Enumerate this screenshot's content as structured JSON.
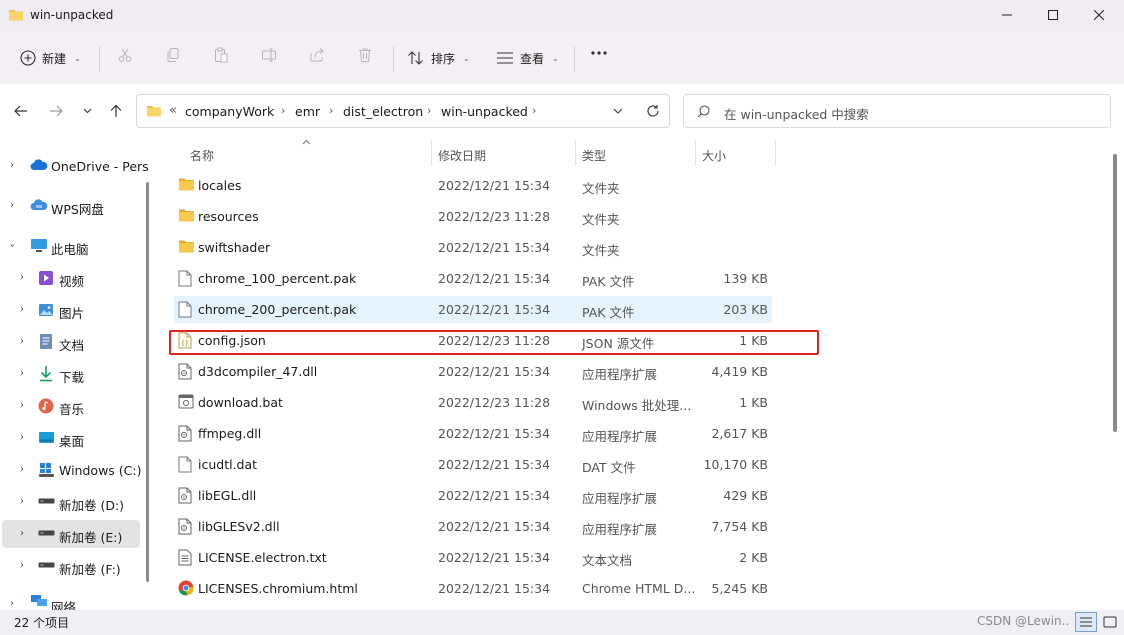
{
  "window": {
    "title": "win-unpacked"
  },
  "commands": {
    "new_label": "新建",
    "sort_label": "排序",
    "view_label": "查看"
  },
  "breadcrumb": {
    "overflow": "«",
    "items": [
      "companyWork",
      "emr",
      "dist_electron",
      "win-unpacked"
    ]
  },
  "search": {
    "placeholder": "在 win-unpacked 中搜索"
  },
  "sidebar": {
    "items": [
      {
        "label": "OneDrive - Pers",
        "icon": "cloud-icon"
      },
      {
        "label": "WPS网盘",
        "icon": "cloud-icon"
      },
      {
        "label": "此电脑",
        "icon": "computer-icon"
      },
      {
        "label": "视频",
        "icon": "video-icon"
      },
      {
        "label": "图片",
        "icon": "picture-icon"
      },
      {
        "label": "文档",
        "icon": "document-icon"
      },
      {
        "label": "下载",
        "icon": "download-icon"
      },
      {
        "label": "音乐",
        "icon": "music-icon"
      },
      {
        "label": "桌面",
        "icon": "desktop-icon"
      },
      {
        "label": "Windows (C:)",
        "icon": "windows-drive-icon"
      },
      {
        "label": "新加卷 (D:)",
        "icon": "drive-icon"
      },
      {
        "label": "新加卷 (E:)",
        "icon": "drive-icon"
      },
      {
        "label": "新加卷 (F:)",
        "icon": "drive-icon"
      },
      {
        "label": "网络",
        "icon": "network-icon"
      }
    ]
  },
  "columns": {
    "name": "名称",
    "date": "修改日期",
    "type": "类型",
    "size": "大小"
  },
  "files": [
    {
      "name": "locales",
      "date": "2022/12/21 15:34",
      "type": "文件夹",
      "size": "",
      "icon": "folder-icon"
    },
    {
      "name": "resources",
      "date": "2022/12/23 11:28",
      "type": "文件夹",
      "size": "",
      "icon": "folder-icon"
    },
    {
      "name": "swiftshader",
      "date": "2022/12/21 15:34",
      "type": "文件夹",
      "size": "",
      "icon": "folder-icon"
    },
    {
      "name": "chrome_100_percent.pak",
      "date": "2022/12/21 15:34",
      "type": "PAK 文件",
      "size": "139 KB",
      "icon": "file-icon"
    },
    {
      "name": "chrome_200_percent.pak",
      "date": "2022/12/21 15:34",
      "type": "PAK 文件",
      "size": "203 KB",
      "icon": "file-icon"
    },
    {
      "name": "config.json",
      "date": "2022/12/23 11:28",
      "type": "JSON 源文件",
      "size": "1 KB",
      "icon": "json-file-icon"
    },
    {
      "name": "d3dcompiler_47.dll",
      "date": "2022/12/21 15:34",
      "type": "应用程序扩展",
      "size": "4,419 KB",
      "icon": "dll-file-icon"
    },
    {
      "name": "download.bat",
      "date": "2022/12/23 11:28",
      "type": "Windows 批处理...",
      "size": "1 KB",
      "icon": "bat-file-icon"
    },
    {
      "name": "ffmpeg.dll",
      "date": "2022/12/21 15:34",
      "type": "应用程序扩展",
      "size": "2,617 KB",
      "icon": "dll-file-icon"
    },
    {
      "name": "icudtl.dat",
      "date": "2022/12/21 15:34",
      "type": "DAT 文件",
      "size": "10,170 KB",
      "icon": "file-icon"
    },
    {
      "name": "libEGL.dll",
      "date": "2022/12/21 15:34",
      "type": "应用程序扩展",
      "size": "429 KB",
      "icon": "dll-file-icon"
    },
    {
      "name": "libGLESv2.dll",
      "date": "2022/12/21 15:34",
      "type": "应用程序扩展",
      "size": "7,754 KB",
      "icon": "dll-file-icon"
    },
    {
      "name": "LICENSE.electron.txt",
      "date": "2022/12/21 15:34",
      "type": "文本文档",
      "size": "2 KB",
      "icon": "text-file-icon"
    },
    {
      "name": "LICENSES.chromium.html",
      "date": "2022/12/21 15:34",
      "type": "Chrome HTML D...",
      "size": "5,245 KB",
      "icon": "chrome-icon"
    }
  ],
  "status": {
    "count": "22 个项目"
  },
  "watermark": "CSDN @Lewin..",
  "colors": {
    "highlight_box": "#e3221b",
    "row_hover": "#e5f3ff",
    "folder": "#f2c04a"
  }
}
